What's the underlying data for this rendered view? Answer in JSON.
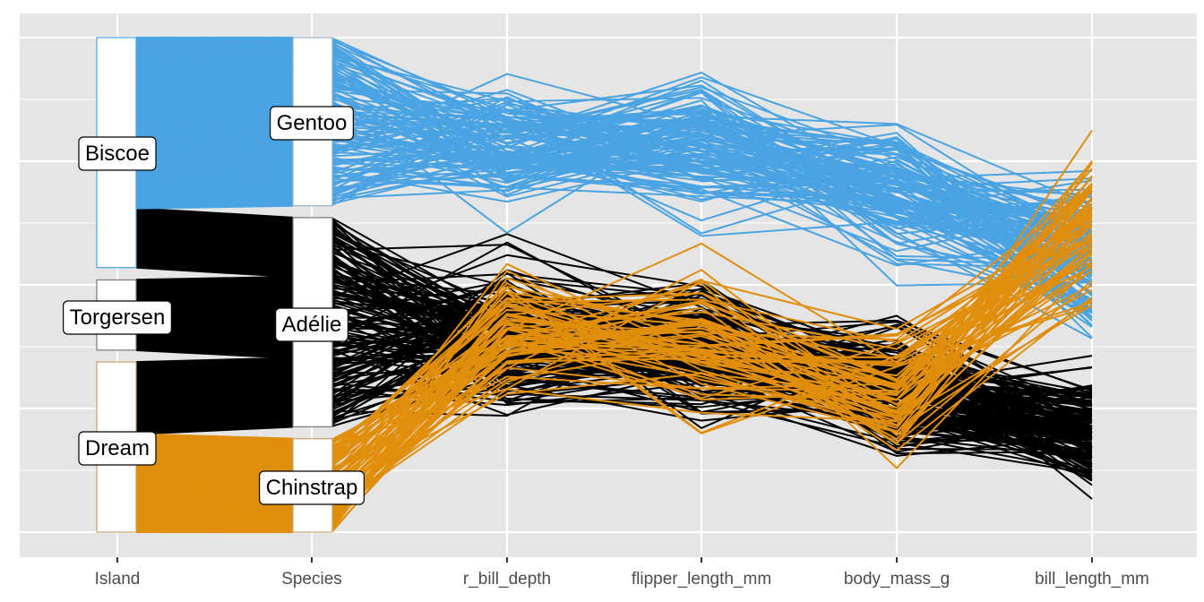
{
  "chart_data": {
    "type": "parallel-coordinates",
    "title": "",
    "xlabel": "",
    "ylabel": "",
    "ylim": [
      0,
      1
    ],
    "grid": true,
    "legend": "none",
    "axes": [
      "Island",
      "Species",
      "r_bill_depth",
      "flipper_length_mm",
      "body_mass_g",
      "bill_length_mm"
    ],
    "categorical_axes": {
      "Island": {
        "levels": [
          {
            "label": "Biscoe",
            "from": 0.535,
            "to": 1.0
          },
          {
            "label": "Torgersen",
            "from": 0.368,
            "to": 0.51
          },
          {
            "label": "Dream",
            "from": 0.0,
            "to": 0.344
          }
        ]
      },
      "Species": {
        "levels": [
          {
            "label": "Gentoo",
            "from": 0.66,
            "to": 1.0
          },
          {
            "label": "Adélie",
            "from": 0.213,
            "to": 0.636
          },
          {
            "label": "Chinstrap",
            "from": 0.0,
            "to": 0.189
          }
        ]
      }
    },
    "series": [
      {
        "name": "Gentoo",
        "color": "#4AA3E2",
        "count": 124,
        "numeric_profile": {
          "r_bill_depth": {
            "min": 0.54,
            "max": 1.0,
            "mean": 0.78
          },
          "flipper_length_mm": {
            "min": 0.42,
            "max": 1.0,
            "mean": 0.78
          },
          "body_mass_g": {
            "min": 0.42,
            "max": 1.0,
            "mean": 0.7
          },
          "bill_length_mm": {
            "min": 0.36,
            "max": 1.0,
            "mean": 0.55
          }
        }
      },
      {
        "name": "Adélie",
        "color": "#000000",
        "count": 152,
        "numeric_profile": {
          "r_bill_depth": {
            "min": 0.0,
            "max": 0.68,
            "mean": 0.4
          },
          "flipper_length_mm": {
            "min": 0.1,
            "max": 0.66,
            "mean": 0.36
          },
          "body_mass_g": {
            "min": 0.06,
            "max": 0.56,
            "mean": 0.28
          },
          "bill_length_mm": {
            "min": 0.0,
            "max": 0.45,
            "mean": 0.2
          }
        }
      },
      {
        "name": "Chinstrap",
        "color": "#E08E0B",
        "count": 68,
        "numeric_profile": {
          "r_bill_depth": {
            "min": 0.09,
            "max": 0.61,
            "mean": 0.4
          },
          "flipper_length_mm": {
            "min": 0.1,
            "max": 0.68,
            "mean": 0.38
          },
          "body_mass_g": {
            "min": 0.0,
            "max": 0.52,
            "mean": 0.28
          },
          "bill_length_mm": {
            "min": 0.25,
            "max": 0.94,
            "mean": 0.62
          }
        }
      }
    ],
    "x_tick_labels": [
      "Island",
      "Species",
      "r_bill_depth",
      "flipper_length_mm",
      "body_mass_g",
      "bill_length_mm"
    ]
  },
  "colors": {
    "panel_background": "#E5E5E5",
    "gridline": "#FFFFFF",
    "tick_label": "#4D4D4D"
  }
}
